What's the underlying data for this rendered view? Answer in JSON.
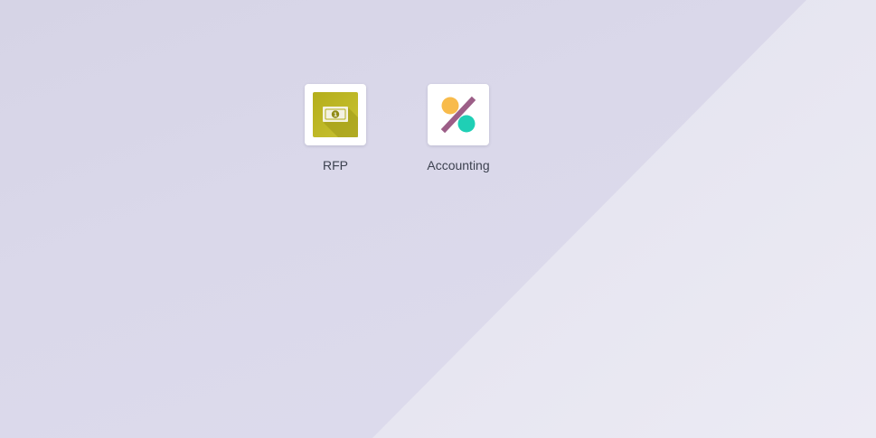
{
  "apps": [
    {
      "label": "RFP",
      "icon": "money-bill-icon",
      "color": "#b7b21c"
    },
    {
      "label": "Accounting",
      "icon": "accounting-percent-icon",
      "colors": [
        "#f8bb4b",
        "#1fcfb5",
        "#94517d"
      ]
    }
  ]
}
